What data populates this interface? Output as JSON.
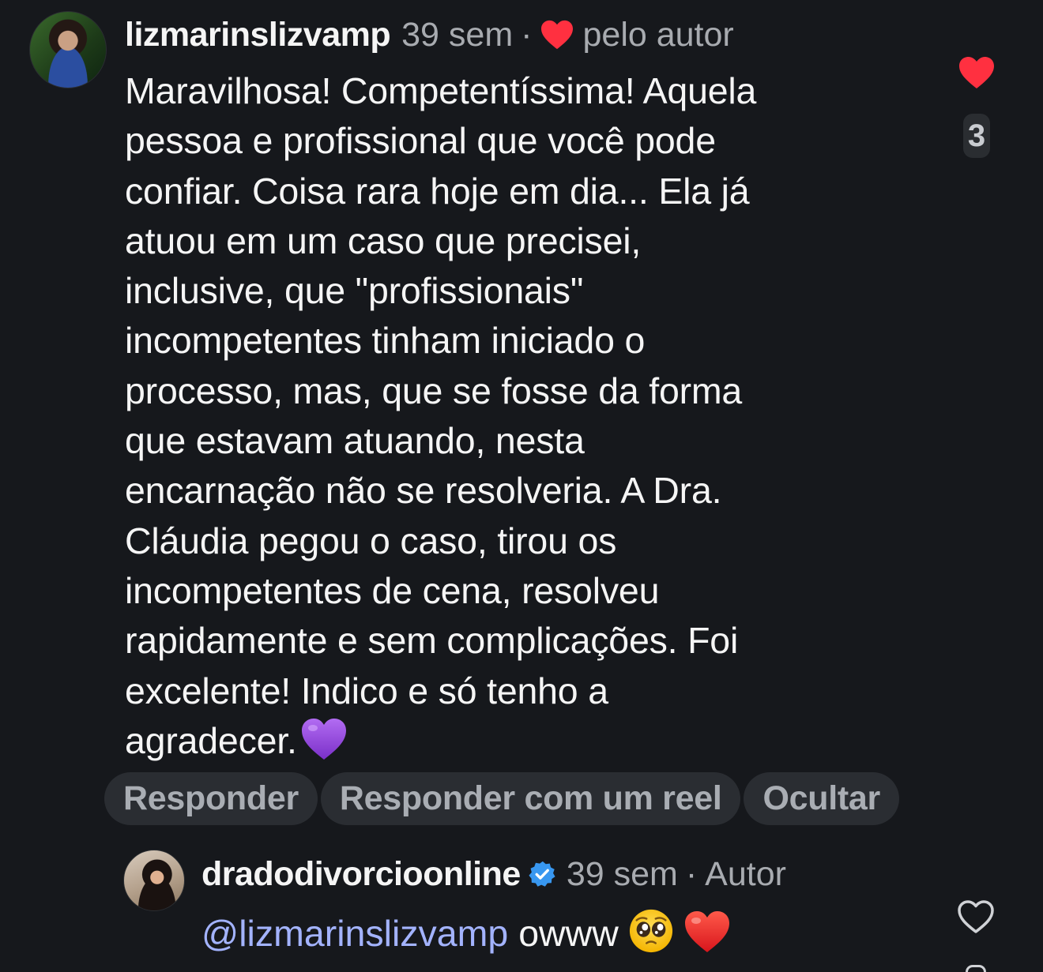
{
  "comment": {
    "username": "lizmarinslizvamp",
    "time": "39 sem",
    "separator": "·",
    "liked_by_author_label": "pelo autor",
    "text_lines": [
      "Maravilhosa! Competentíssima! Aquela",
      "pessoa e profissional que você pode",
      "confiar. Coisa rara hoje em dia... Ela já",
      "atuou em um caso que precisei,",
      "inclusive, que \"profissionais\"",
      "incompetentes tinham iniciado o",
      "processo, mas, que se fosse da forma",
      "que estavam atuando, nesta",
      "encarnação não se resolveria. A Dra.",
      "Cláudia pegou o caso, tirou os",
      "incompetentes de cena, resolveu",
      "rapidamente e sem complicações. Foi",
      "excelente! Indico e só tenho a",
      "agradecer."
    ],
    "end_emoji_icon": "purple-heart-icon",
    "like_count": "3",
    "like_state": "liked",
    "like_color": "#ff3040"
  },
  "actions": {
    "reply_label": "Responder",
    "reply_reel_label": "Responder com um reel",
    "hide_label": "Ocultar"
  },
  "reply": {
    "username": "dradodivorcioonline",
    "verified": true,
    "verified_color": "#3897f0",
    "time": "39 sem",
    "separator": "·",
    "author_label": "Autor",
    "mention": "@lizmarinslizvamp",
    "text": "owww",
    "emojis": [
      "pleading-face-icon",
      "red-heart-icon"
    ],
    "like_state": "not-liked",
    "mention_color": "#a3b3ff"
  },
  "colors": {
    "background": "#16181c",
    "text_primary": "#f5f5f5",
    "text_secondary": "#a8abb0",
    "button_background": "#2a2d32",
    "purple_heart": "#9b4fe0"
  }
}
